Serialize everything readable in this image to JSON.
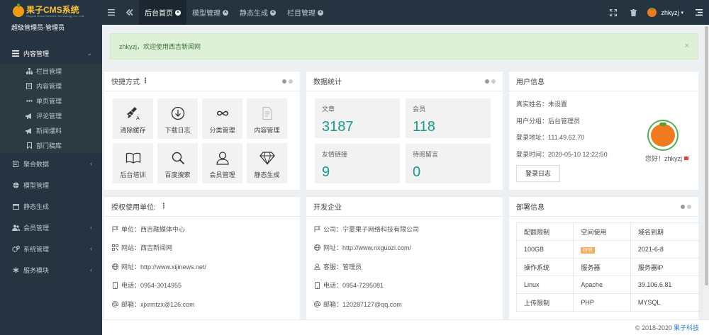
{
  "brand": {
    "title": "果子CMS系统",
    "subtitle": "Ningxia Guozi Network Technology Co., Ltd.",
    "role": "超级管理员-管理员"
  },
  "sidebar": {
    "open": {
      "label": "内容管理"
    },
    "sub_items": [
      {
        "label": "栏目管理",
        "icon": "sitemap-icon"
      },
      {
        "label": "内容管理",
        "icon": "document-icon"
      },
      {
        "label": "单页管理",
        "icon": "ellipsis-icon"
      },
      {
        "label": "评论管理",
        "icon": "bullhorn-icon"
      },
      {
        "label": "新闻爆料",
        "icon": "bullhorn-icon"
      },
      {
        "label": "部门稿库",
        "icon": "bookmark-icon"
      }
    ],
    "items": [
      {
        "label": "聚合数据"
      },
      {
        "label": "模型管理"
      },
      {
        "label": "静态生成"
      },
      {
        "label": "会员管理"
      },
      {
        "label": "系统管理"
      },
      {
        "label": "服务模块"
      }
    ]
  },
  "tabs": [
    {
      "label": "后台首页"
    },
    {
      "label": "模型管理"
    },
    {
      "label": "静态生成"
    },
    {
      "label": "栏目管理"
    }
  ],
  "user": {
    "name": "zhkyzj"
  },
  "alert": {
    "message": "zhkyzj，欢迎使用西吉新闻网",
    "close": "×"
  },
  "quick": {
    "title": "快捷方式",
    "tiles": [
      {
        "label": "清除缓存",
        "icon": "broom-icon"
      },
      {
        "label": "下载日志",
        "icon": "download-icon"
      },
      {
        "label": "分类管理",
        "icon": "infinity-icon"
      },
      {
        "label": "内容管理",
        "icon": "document-icon"
      },
      {
        "label": "后台培训",
        "icon": "book-icon"
      },
      {
        "label": "百度搜索",
        "icon": "search-icon"
      },
      {
        "label": "会员管理",
        "icon": "user-icon"
      },
      {
        "label": "静态生成",
        "icon": "diamond-icon"
      }
    ]
  },
  "stats": {
    "title": "数据统计",
    "items": [
      {
        "label": "文章",
        "value": "3187"
      },
      {
        "label": "会员",
        "value": "118"
      },
      {
        "label": "友情链接",
        "value": "9"
      },
      {
        "label": "待阅留言",
        "value": "0"
      }
    ]
  },
  "userinfo": {
    "title": "用户信息",
    "rows": [
      {
        "text": "真实姓名：未设置"
      },
      {
        "text": "用户分组：后台管理员"
      },
      {
        "text": "登录地址：111.49.62.70"
      },
      {
        "text": "登录时间：2020-05-10 12:22:50"
      }
    ],
    "login_log_button": "登录日志",
    "greeting": "您好！zhkyzj"
  },
  "license": {
    "title": "授权使用单位:",
    "rows": [
      {
        "icon": "flag-icon",
        "text": "单位：西吉融媒体中心"
      },
      {
        "icon": "qrcode-icon",
        "text": "网站：西吉新闻网"
      },
      {
        "icon": "globe-icon",
        "text": "网址：http://www.xijinews.net/"
      },
      {
        "icon": "mobile-icon",
        "text": "电话：0954-3014955"
      },
      {
        "icon": "at-icon",
        "text": "邮箱：xjxrmtzx@126.com"
      }
    ]
  },
  "developer": {
    "title": "开发企业",
    "rows": [
      {
        "icon": "flag-icon",
        "text": "公司：宁夏果子网络科技有限公司"
      },
      {
        "icon": "globe-icon",
        "text": "网址：http://www.nxguozi.com/"
      },
      {
        "icon": "user-icon",
        "text": "客服：管理员"
      },
      {
        "icon": "mobile-icon",
        "text": "电话：0954-7295081"
      },
      {
        "icon": "at-icon",
        "text": "邮箱：120287127@qq.com"
      }
    ]
  },
  "deploy": {
    "title": "部署信息",
    "rows": [
      [
        "配额限制",
        "空间使用",
        "域名到期"
      ],
      [
        "100GB",
        "0KB",
        "2021-6-8"
      ],
      [
        "操作系统",
        "服务器",
        "服务器IP"
      ],
      [
        "Linux",
        "Apache",
        "39.106.6.81"
      ],
      [
        "上传限制",
        "PHP",
        "MYSQL"
      ]
    ]
  },
  "footer": {
    "copyright": "© 2018-2020",
    "company": "果子科技"
  },
  "colors": {
    "sidebar": "#263442",
    "accent": "#179c89",
    "badge": "#f8ac59"
  }
}
